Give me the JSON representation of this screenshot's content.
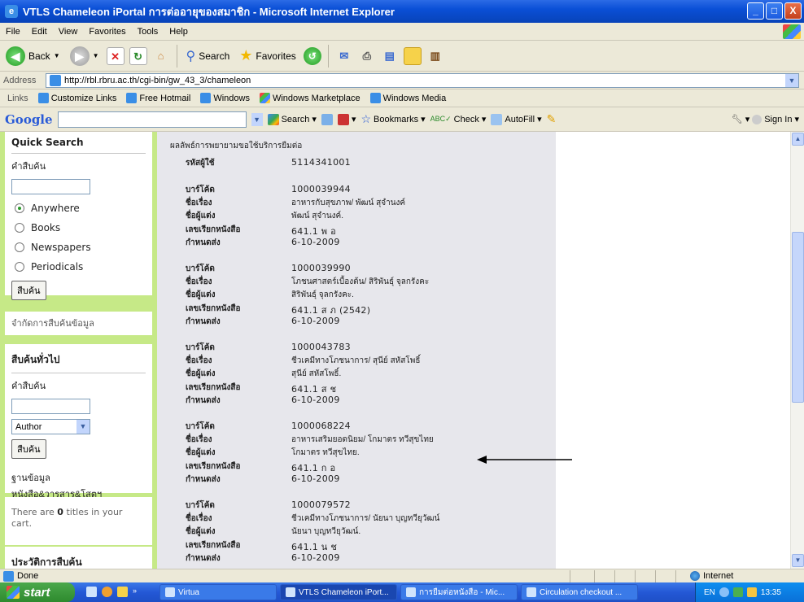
{
  "window": {
    "title": "VTLS Chameleon iPortal การต่ออายุของสมาชิก - Microsoft Internet Explorer",
    "controls": [
      "_",
      "□",
      "X"
    ]
  },
  "menu": [
    "File",
    "Edit",
    "View",
    "Favorites",
    "Tools",
    "Help"
  ],
  "toolbar": {
    "back_label": "Back",
    "search_label": "Search",
    "favorites_label": "Favorites"
  },
  "address": {
    "label": "Address",
    "url": "http://rbl.rbru.ac.th/cgi-bin/gw_43_3/chameleon"
  },
  "links": {
    "label": "Links",
    "items": [
      "Customize Links",
      "Free Hotmail",
      "Windows",
      "Windows Marketplace",
      "Windows Media"
    ]
  },
  "google": {
    "logo": "Google",
    "search": "Search",
    "bookmarks": "Bookmarks",
    "check": "Check",
    "autofill": "AutoFill",
    "signin": "Sign In"
  },
  "sidebar": {
    "quick_search": {
      "heading": "Quick Search",
      "label": "คำสืบค้น",
      "options": [
        {
          "label": "Anywhere",
          "selected": true
        },
        {
          "label": "Books",
          "selected": false
        },
        {
          "label": "Newspapers",
          "selected": false
        },
        {
          "label": "Periodicals",
          "selected": false
        }
      ],
      "button": "สืบค้น"
    },
    "limit_link": "จำกัดการสืบค้นข้อมูล",
    "general_search": {
      "heading": "สืบค้นทั่วไป",
      "label": "คำสืบค้น",
      "select_value": "Author",
      "button": "สืบค้น",
      "db_label": "ฐานข้อมูล",
      "db_value": "หนังสือ&วารสาร&โสตฯ"
    },
    "cart": {
      "prefix": "There are ",
      "count": "0",
      "suffix": " titles in your cart."
    },
    "history": "ประวัติการสืบค้น"
  },
  "main": {
    "result_title": "ผลลัพธ์การพยายามขอใช้บริการยืมต่อ",
    "user_label": "รหัสผู้ใช้",
    "user_id": "5114341001",
    "field_labels": {
      "barcode": "บาร์โค้ด",
      "title": "ชื่อเรื่อง",
      "author": "ชื่อผู้แต่ง",
      "callno": "เลขเรียกหนังสือ",
      "due": "กำหนดส่ง"
    },
    "items": [
      {
        "barcode": "1000039944",
        "title": "อาหารกับสุขภาพ/ พัฒน์ สุจำนงค์",
        "author": "พัฒน์ สุจำนงค์.",
        "callno": "641.1 พ อ",
        "due": "6-10-2009"
      },
      {
        "barcode": "1000039990",
        "title": "โภชนศาสตร์เบื้องต้น/ สิริพันธุ์ จุลกรังคะ",
        "author": "สิริพันธุ์ จุลกรังคะ.",
        "callno": "641.1 ส ภ (2542)",
        "due": "6-10-2009"
      },
      {
        "barcode": "1000043783",
        "title": "ชีวเคมีทางโภชนาการ/ สุนีย์ สหัสโพธิ์",
        "author": "สุนีย์ สหัสโพธิ์.",
        "callno": "641.1 ส ช",
        "due": "6-10-2009"
      },
      {
        "barcode": "1000068224",
        "title": "อาหารเสริมยอดนิยม/ โกมาตร ทวีสุขไทย",
        "author": "โกมาตร ทวีสุขไทย.",
        "callno": "641.1 ก อ",
        "due": "6-10-2009"
      },
      {
        "barcode": "1000079572",
        "title": "ชีวเคมีทางโภชนาการ/ นัยนา บุญทวียุวัฒน์",
        "author": "นัยนา บุญทวียุวัฒน์.",
        "callno": "641.1 น ช",
        "due": "6-10-2009"
      }
    ]
  },
  "status": {
    "text": "Done",
    "zone": "Internet"
  },
  "taskbar": {
    "start": "start",
    "buttons": [
      "Virtua",
      "VTLS Chameleon iPort...",
      "การยืมต่อหนังสือ - Mic...",
      "Circulation checkout ..."
    ],
    "lang": "EN",
    "clock": "13:35"
  }
}
